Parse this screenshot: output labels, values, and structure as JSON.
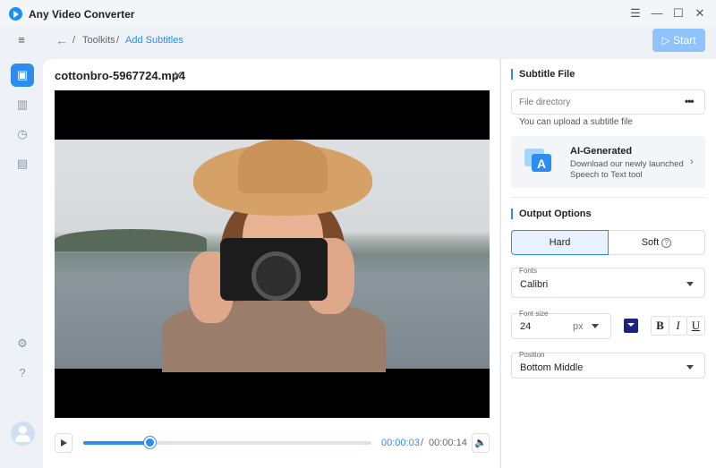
{
  "app": {
    "title": "Any Video Converter"
  },
  "breadcrumb": {
    "separator": "/",
    "toolkits": "Toolkits",
    "current": "Add Subtitles"
  },
  "toolbar": {
    "start_label": "Start"
  },
  "video": {
    "filename": "cottonbro-5967724.mp4",
    "current_time": "00:00:03",
    "time_separator": "/",
    "duration": "00:00:14",
    "progress": 0.23
  },
  "subtitle_file": {
    "heading": "Subtitle File",
    "placeholder": "File directory",
    "more_label": "•••",
    "hint": "You can upload a subtitle file"
  },
  "ai_card": {
    "title": "AI-Generated",
    "description": "Download our newly launched Speech to Text tool"
  },
  "output_options": {
    "heading": "Output Options",
    "hard_label": "Hard",
    "soft_label": "Soft",
    "fonts_label": "Fonts",
    "font_value": "Calibri",
    "font_size_label": "Font size",
    "font_size_value": "24",
    "font_size_unit": "px",
    "font_color": "#1a237e",
    "bold_label": "B",
    "italic_label": "I",
    "underline_label": "U",
    "position_label": "Position",
    "position_value": "Bottom Middle"
  },
  "colors": {
    "accent": "#2d8cf0",
    "start_disabled": "#8fc3fb"
  },
  "icons": {
    "sidebar": [
      "menu-collapse-icon",
      "toolbox-icon",
      "library-icon",
      "history-icon",
      "tasks-icon",
      "settings-icon",
      "help-icon",
      "avatar-icon"
    ]
  }
}
